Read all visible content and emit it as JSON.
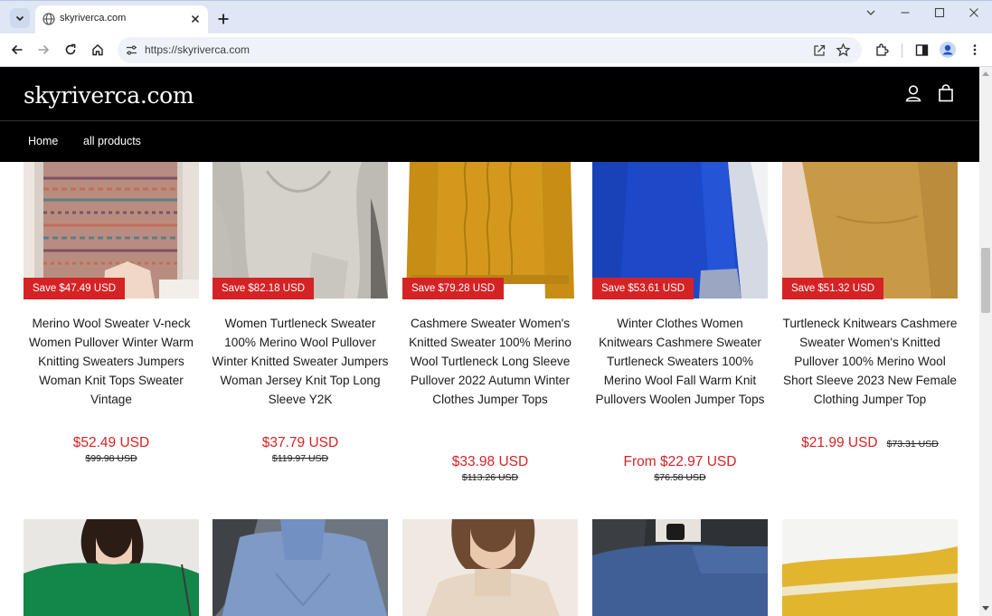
{
  "browser": {
    "tab_title": "skyriverca.com",
    "url": "https://skyriverca.com"
  },
  "site": {
    "logo": "skyriverca.com",
    "nav": [
      "Home",
      "all products"
    ]
  },
  "colors": {
    "header_bg": "#000000",
    "sale_red": "#d52325"
  },
  "products": [
    {
      "badge": "Save $47.49 USD",
      "title": "Merino Wool Sweater V-neck Women Pullover Winter Warm Knitting Sweaters Jumpers Woman Knit Tops Sweater Vintage",
      "price": "$52.49 USD",
      "compare": "$99.98 USD",
      "image": "fair-isle-sweater"
    },
    {
      "badge": "Save $82.18 USD",
      "title": "Women Turtleneck Sweater 100% Merino Wool Pullover Winter Knitted Sweater Jumpers Woman Jersey Knit Top Long Sleeve Y2K",
      "price": "$37.79 USD",
      "compare": "$119.97 USD",
      "image": "grey-knit-sweater"
    },
    {
      "badge": "Save $79.28 USD",
      "title": "Cashmere Sweater Women's Knitted Sweater 100% Merino Wool Turtleneck Long Sleeve Pullover 2022 Autumn Winter Clothes Jumper Tops",
      "price": "$33.98 USD",
      "compare": "$113.26 USD",
      "image": "mustard-cable-sweater"
    },
    {
      "badge": "Save $53.61 USD",
      "title": "Winter Clothes Women Knitwears Cashmere Sweater Turtleneck Sweaters 100% Merino Wool Fall Warm Knit Pullovers Woolen Jumper Tops",
      "price": "From $22.97 USD",
      "compare": "$76.58 USD",
      "image": "blue-turtleneck"
    },
    {
      "badge": "Save $51.32 USD",
      "title": "Turtleneck Knitwears Cashmere Sweater Women's Knitted Pullover 100% Merino Wool Short Sleeve 2023 New Female Clothing Jumper Top",
      "price": "$21.99 USD",
      "compare": "$73.31 USD",
      "image": "camel-short-sleeve"
    }
  ],
  "second_row_images": [
    "green-sweater",
    "blue-turtleneck-model",
    "beige-turtleneck-model",
    "navy-turtleneck-camera",
    "folded-yellow-sweater"
  ]
}
